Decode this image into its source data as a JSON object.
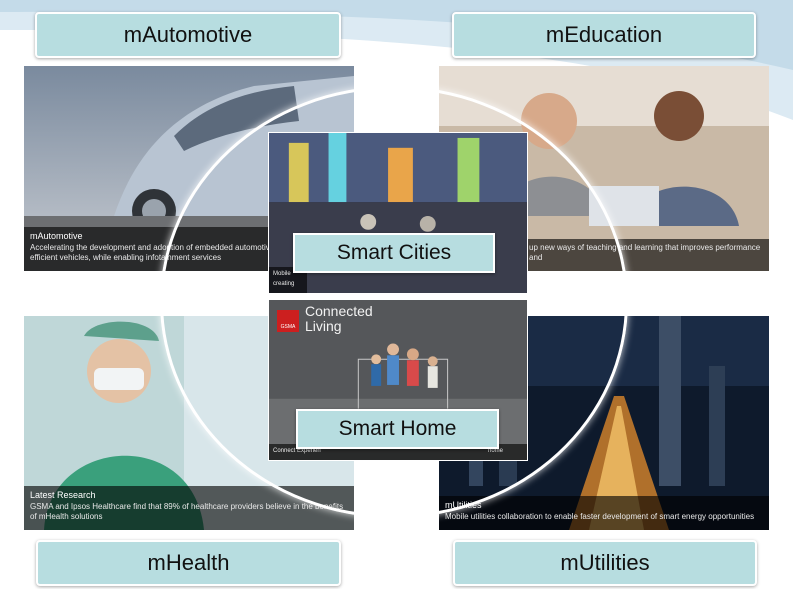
{
  "labels": {
    "automotive": "mAutomotive",
    "education": "mEducation",
    "health": "mHealth",
    "utilities": "mUtilities",
    "smart_cities": "Smart Cities",
    "smart_home": "Smart Home"
  },
  "panels": {
    "automotive": {
      "title": "mAutomotive",
      "text": "Accelerating the development and adoption of embedded automotive solutions for safer, efficient vehicles, while enabling infotainment services"
    },
    "education": {
      "text": "up new ways of teaching and learning that improves performance and"
    },
    "health": {
      "title": "Latest Research",
      "text": "GSMA and Ipsos Healthcare find that 89% of healthcare providers believe in the benefits of mHealth solutions"
    },
    "utilities": {
      "title": "mUtilities",
      "text": "Mobile utilities collaboration to enable faster development of smart energy opportunities"
    },
    "cities": {
      "text": "Mobile creating"
    },
    "home": {
      "logo": "GSMA",
      "line1": "Connected",
      "line2": "Living",
      "text_left": "Connect Experien",
      "text_right": "home"
    }
  },
  "colors": {
    "label_bg": "#b7dde0",
    "swoosh": "#cfe3ef"
  }
}
